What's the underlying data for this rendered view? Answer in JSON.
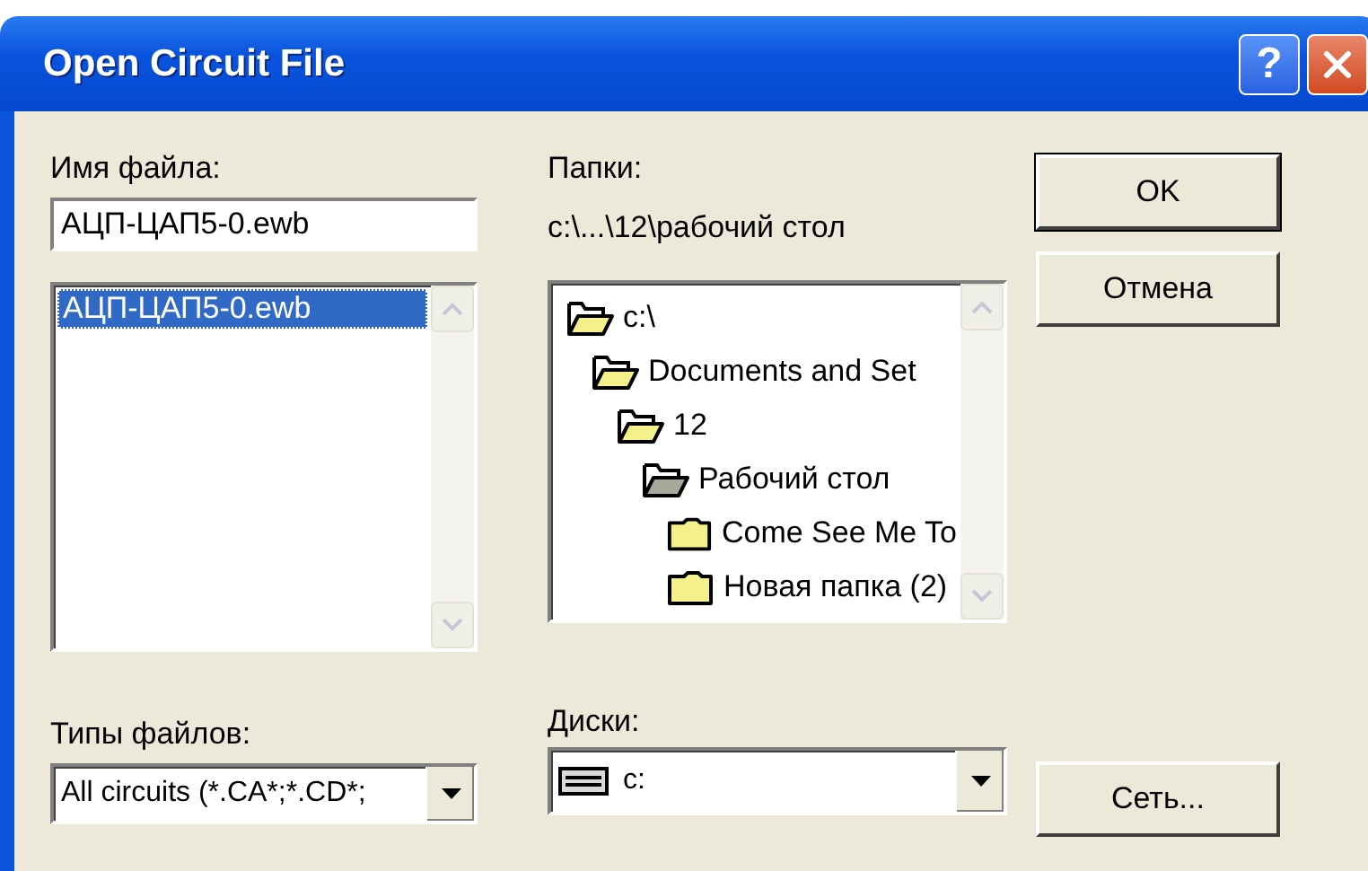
{
  "window": {
    "title": "Open Circuit File",
    "help_glyph": "?"
  },
  "file_name": {
    "label": "Имя файла:",
    "value": "АЦП-ЦАП5-0.ewb"
  },
  "file_list": [
    {
      "name": "АЦП-ЦАП5-0.ewb",
      "selected": true
    }
  ],
  "file_types": {
    "label": "Типы файлов:",
    "value": "All circuits (*.CA*;*.CD*;"
  },
  "folders": {
    "label": "Папки:",
    "path": "c:\\...\\12\\рабочий стол",
    "tree": [
      {
        "name": "c:\\",
        "open": true,
        "children": [
          {
            "name": "Documents and Set",
            "open": true,
            "children": [
              {
                "name": "12",
                "open": true,
                "children": [
                  {
                    "name": "Рабочий стол",
                    "open": true,
                    "children": [
                      {
                        "name": "Come See Me To",
                        "open": false
                      },
                      {
                        "name": "Новая папка (2)",
                        "open": false
                      }
                    ]
                  }
                ]
              }
            ]
          }
        ]
      }
    ]
  },
  "drives": {
    "label": "Диски:",
    "value": "c:"
  },
  "buttons": [
    {
      "label": "OK",
      "kind": "default"
    },
    {
      "label": "Отмена",
      "kind": "normal"
    },
    {
      "label": "Сеть...",
      "kind": "normal"
    }
  ]
}
